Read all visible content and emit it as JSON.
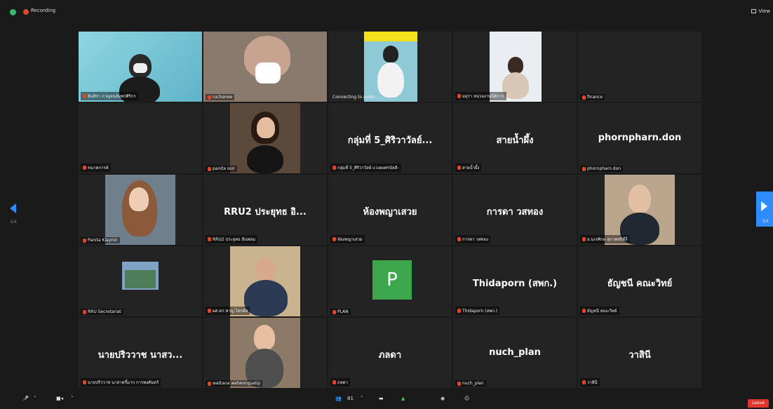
{
  "top": {
    "recording_label": "Recording",
    "view_label": "View"
  },
  "tiles": [
    {
      "label": "อินทิรา กาญจนอัมพรศิริกร",
      "type": "video"
    },
    {
      "label": "ruchanee",
      "type": "video"
    },
    {
      "label": "Connecting to audio ...",
      "type": "video"
    },
    {
      "label": "มยุรา หน่วยงานนิติการ",
      "type": "video"
    },
    {
      "label": "finance",
      "type": "blank"
    },
    {
      "label": "ขนาดการค์",
      "type": "blank"
    },
    {
      "label": "panita son",
      "type": "video"
    },
    {
      "name": "กลุ่มที่ 5_ศิริวาวัลย์...",
      "label": "กลุ่มที่ 5_ศิริวาวัลย์ แวงดงศรบัลลิ-",
      "type": "name"
    },
    {
      "name": "สายน้ำผึ้ง",
      "label": "สายน้ำผึ้ง",
      "type": "name"
    },
    {
      "name": "phornpharn.don",
      "label": "phornpharn.don",
      "type": "name"
    },
    {
      "label": "Panita Klaynin",
      "type": "video"
    },
    {
      "name": "RRU2 ประยุทธ อิ...",
      "label": "RRU2 ประยุทธ อินพลม",
      "type": "name"
    },
    {
      "name": "ห้องพญาเสวย",
      "label": "ห้องพญาเสวย",
      "type": "name"
    },
    {
      "name": "การดา วสทอง",
      "label": "การดา วสทอง",
      "type": "name"
    },
    {
      "label": "อ.นเรศักษ สุภาพสกิดีงี่",
      "type": "video"
    },
    {
      "label": "RRU Secretariat",
      "type": "video"
    },
    {
      "label": "ผศ.ดร.ชาญ ไทรอัล",
      "type": "video"
    },
    {
      "label": "PLAN",
      "type": "avatar",
      "avatar": "P"
    },
    {
      "name": "Thidaporn (สพก.)",
      "label": "Thidaporn (สพก.)",
      "type": "name"
    },
    {
      "name": "ธัญชนี คณะวิทย์",
      "label": "ธัญชนี คณะวิทย์",
      "type": "name"
    },
    {
      "name": "นายปริววาช นาสว...",
      "label": "นายปริววาช นาสาดกิ์มาก การพงศ์นทร์",
      "type": "name"
    },
    {
      "label": "wattana wetwongsatip",
      "type": "video"
    },
    {
      "name": "ภลดา",
      "label": "ภลดา",
      "type": "name"
    },
    {
      "name": "nuch_plan",
      "label": "nuch_plan",
      "type": "name"
    },
    {
      "name": "วาสินี",
      "label": "วาสินี",
      "type": "name"
    }
  ],
  "pager": {
    "prev": "3/4",
    "next": "3/4"
  },
  "toolbar": {
    "participants_count": "81",
    "leave": "Leave"
  },
  "colors": {
    "accent": "#2d8cff",
    "record": "#e0452a",
    "avatar": "#3da74c"
  }
}
